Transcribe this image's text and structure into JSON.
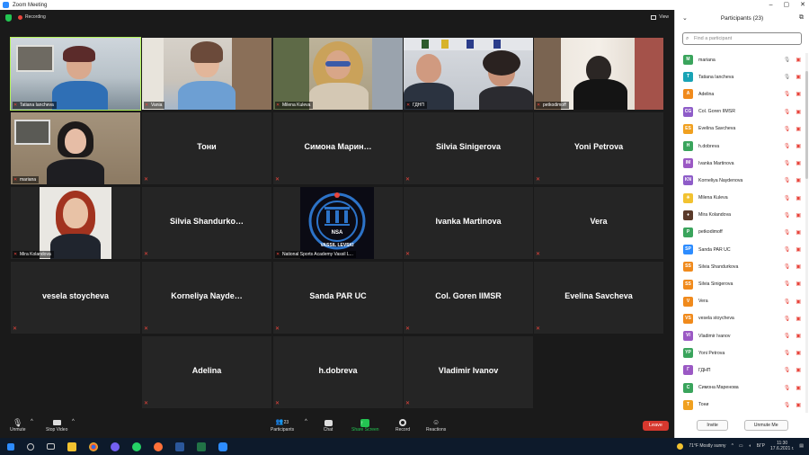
{
  "window": {
    "title": "Zoom Meeting",
    "controls": [
      "–",
      "▢",
      "✕"
    ]
  },
  "meeting": {
    "recording_label": "Recording",
    "view_label": "View"
  },
  "tiles_named": [
    {
      "id": "toni",
      "label": "Тони"
    },
    {
      "id": "simona",
      "label": "Симона  Марин…"
    },
    {
      "id": "silvia-sin",
      "label": "Silvia Sinigerova"
    },
    {
      "id": "yoni",
      "label": "Yoni Petrova"
    },
    {
      "id": "silvia-sha",
      "label": "Silvia  Shandurko…"
    },
    {
      "id": "ivanka",
      "label": "Ivanka Martinova"
    },
    {
      "id": "vera",
      "label": "Vera"
    },
    {
      "id": "vesela",
      "label": "vesela stoycheva"
    },
    {
      "id": "korneliya",
      "label": "Korneliya  Nayde…"
    },
    {
      "id": "sanda",
      "label": "Sanda PAR UC"
    },
    {
      "id": "goren",
      "label": "Col. Goren IIMSR"
    },
    {
      "id": "evelina",
      "label": "Evelina Savcheva"
    },
    {
      "id": "adelina",
      "label": "Adelina"
    },
    {
      "id": "hdobreva",
      "label": "h.dobreva"
    },
    {
      "id": "vladimir",
      "label": "Vladimir Ivanov"
    }
  ],
  "tiles_video": [
    {
      "id": "tatiana",
      "caption": "Tatiana Iancheva"
    },
    {
      "id": "vania",
      "caption": "Vania"
    },
    {
      "id": "milena",
      "caption": "Milena Kuleva"
    },
    {
      "id": "gdnp",
      "caption": "ГДНП"
    },
    {
      "id": "petko",
      "caption": "petkodimoff"
    },
    {
      "id": "mariana",
      "caption": "mariana"
    },
    {
      "id": "mira",
      "caption": "Mira Kolandova"
    },
    {
      "id": "nsa",
      "caption": "National Sports Academy Vassil L..."
    }
  ],
  "nsa_logo": {
    "top": "NSA",
    "bottom": "VASSIL LEVSKI"
  },
  "toolbar": {
    "unmute": "Unmute",
    "stop_video": "Stop Video",
    "participants": "Participants",
    "participants_count": "23",
    "chat": "Chat",
    "share_screen": "Share Screen",
    "record": "Record",
    "reactions": "Reactions",
    "leave": "Leave"
  },
  "panel": {
    "title": "Participants (23)",
    "search_placeholder": "Find a participant",
    "invite": "Invite",
    "unmute_me": "Unmute Me"
  },
  "participants": [
    {
      "initials": "M",
      "name": "mariana",
      "color": "#3aa45c",
      "mic": "on"
    },
    {
      "initials": "T",
      "name": "Tatiana Iancheva",
      "color": "#19a3b5",
      "mic": "on"
    },
    {
      "initials": "A",
      "name": "Adelina",
      "color": "#f08a1c",
      "mic": "off"
    },
    {
      "initials": "CG",
      "name": "Col. Goren IIMSR",
      "color": "#8e5cc8",
      "mic": "off"
    },
    {
      "initials": "ES",
      "name": "Evelina Savcheva",
      "color": "#f0a020",
      "mic": "off"
    },
    {
      "initials": "H",
      "name": "h.dobreva",
      "color": "#3aa45c",
      "mic": "off"
    },
    {
      "initials": "IM",
      "name": "Ivanka Martinova",
      "color": "#9b59c4",
      "mic": "off"
    },
    {
      "initials": "KN",
      "name": "Korneliya Naydenova",
      "color": "#8e5cc8",
      "mic": "off"
    },
    {
      "initials": "☀",
      "name": "Milena Kuleva",
      "color": "#f2c230",
      "mic": "off"
    },
    {
      "initials": "♦",
      "name": "Mira Kolandova",
      "color": "#5a3a2a",
      "mic": "off"
    },
    {
      "initials": "P",
      "name": "petkodimoff",
      "color": "#3aa45c",
      "mic": "off"
    },
    {
      "initials": "SP",
      "name": "Sanda PAR UC",
      "color": "#2d8cff",
      "mic": "off"
    },
    {
      "initials": "SS",
      "name": "Silvia Shandurkova",
      "color": "#f08a1c",
      "mic": "off"
    },
    {
      "initials": "SS",
      "name": "Silvia Sinigerova",
      "color": "#f08a1c",
      "mic": "off"
    },
    {
      "initials": "V",
      "name": "Vera",
      "color": "#f08a1c",
      "mic": "off"
    },
    {
      "initials": "VS",
      "name": "vesela stoycheva",
      "color": "#f08a1c",
      "mic": "off"
    },
    {
      "initials": "VI",
      "name": "Vladimir Ivanov",
      "color": "#9b59c4",
      "mic": "off"
    },
    {
      "initials": "YP",
      "name": "Yoni Petrova",
      "color": "#3aa45c",
      "mic": "off"
    },
    {
      "initials": "Г",
      "name": "ГДНП",
      "color": "#9b59c4",
      "mic": "off"
    },
    {
      "initials": "С",
      "name": "Симона Маренова",
      "color": "#3aa45c",
      "mic": "off"
    },
    {
      "initials": "T",
      "name": "Тони",
      "color": "#f0a020",
      "mic": "off"
    }
  ],
  "taskbar": {
    "weather": "71°F  Mostly sunny",
    "lang": "БГР",
    "time": "11:30",
    "date": "17.6.2021 г."
  }
}
